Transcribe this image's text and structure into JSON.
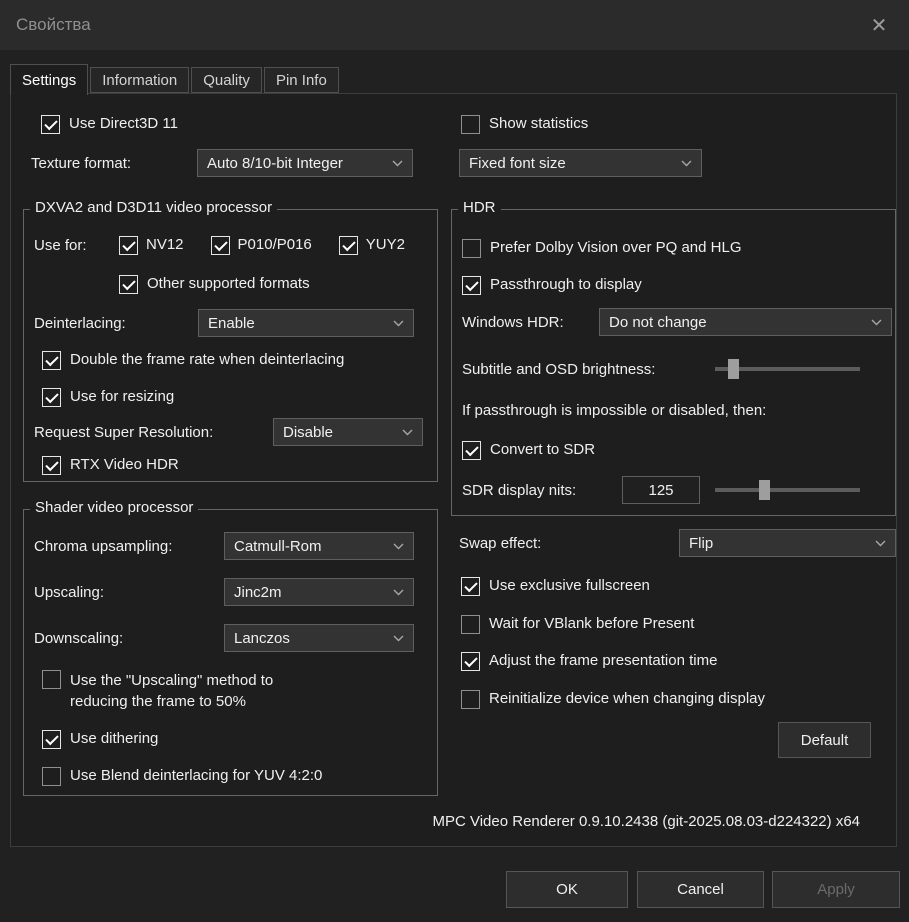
{
  "window": {
    "title": "Свойства",
    "close_icon": "✕"
  },
  "tabs": {
    "settings": "Settings",
    "information": "Information",
    "quality": "Quality",
    "pin_info": "Pin Info"
  },
  "settings": {
    "use_direct3d11": {
      "label": "Use Direct3D 11",
      "checked": true
    },
    "texture_format": {
      "label": "Texture format:",
      "value": "Auto 8/10-bit Integer"
    },
    "show_statistics": {
      "label": "Show statistics",
      "checked": false
    },
    "font_size": {
      "value": "Fixed font size"
    },
    "dxva_group": {
      "title": "DXVA2 and D3D11 video processor",
      "use_for_label": "Use for:",
      "nv12": {
        "label": "NV12",
        "checked": true
      },
      "p010": {
        "label": "P010/P016",
        "checked": true
      },
      "yuy2": {
        "label": "YUY2",
        "checked": true
      },
      "other_formats": {
        "label": "Other supported formats",
        "checked": true
      },
      "deinterlacing": {
        "label": "Deinterlacing:",
        "value": "Enable"
      },
      "double_frame_rate": {
        "label": "Double the frame rate when deinterlacing",
        "checked": true
      },
      "use_for_resizing": {
        "label": "Use for resizing",
        "checked": true
      },
      "super_resolution": {
        "label": "Request Super Resolution:",
        "value": "Disable"
      },
      "rtx_video_hdr": {
        "label": "RTX Video HDR",
        "checked": true
      }
    },
    "shader_group": {
      "title": "Shader video processor",
      "chroma_upsampling": {
        "label": "Chroma upsampling:",
        "value": "Catmull-Rom"
      },
      "upscaling": {
        "label": "Upscaling:",
        "value": "Jinc2m"
      },
      "downscaling": {
        "label": "Downscaling:",
        "value": "Lanczos"
      },
      "upscaling_half": {
        "label": "Use the \"Upscaling\" method to reducing the frame to 50%",
        "checked": false
      },
      "use_dithering": {
        "label": "Use dithering",
        "checked": true
      },
      "blend_deinterlacing": {
        "label": "Use Blend deinterlacing for YUV 4:2:0",
        "checked": false
      }
    },
    "hdr_group": {
      "title": "HDR",
      "prefer_dolby_vision": {
        "label": "Prefer Dolby Vision over PQ and HLG",
        "checked": false
      },
      "passthrough_display": {
        "label": "Passthrough to display",
        "checked": true
      },
      "windows_hdr": {
        "label": "Windows HDR:",
        "value": "Do not change"
      },
      "osd_brightness_label": "Subtitle and OSD brightness:",
      "passthrough_note": "If passthrough is impossible or disabled, then:",
      "convert_to_sdr": {
        "label": "Convert to SDR",
        "checked": true
      },
      "sdr_display_nits": {
        "label": "SDR display nits:",
        "value": "125"
      }
    },
    "swap_effect": {
      "label": "Swap effect:",
      "value": "Flip"
    },
    "exclusive_fullscreen": {
      "label": "Use exclusive fullscreen",
      "checked": true
    },
    "wait_vblank": {
      "label": "Wait for VBlank before Present",
      "checked": false
    },
    "adjust_presentation_time": {
      "label": "Adjust the frame presentation time",
      "checked": true
    },
    "reinitialize_device": {
      "label": "Reinitialize device when changing display",
      "checked": false
    },
    "default_button": "Default",
    "version": "MPC Video Renderer 0.9.10.2438 (git-2025.08.03-d224322) x64"
  },
  "dialog_buttons": {
    "ok": "OK",
    "cancel": "Cancel",
    "apply": "Apply",
    "apply_enabled": false
  }
}
